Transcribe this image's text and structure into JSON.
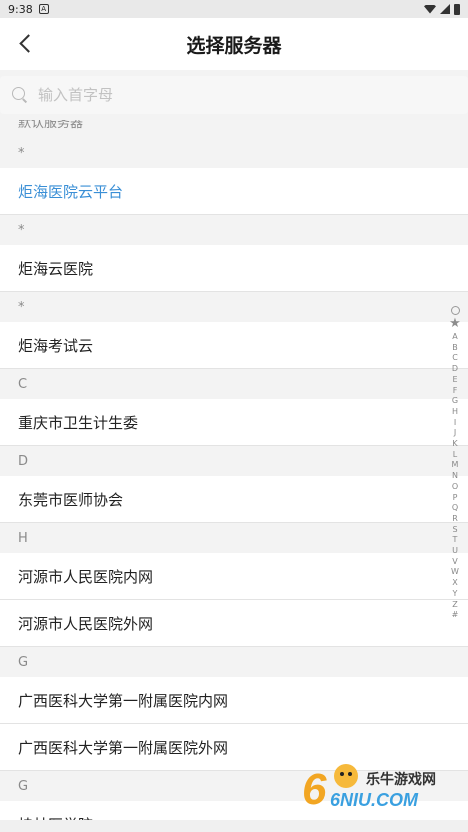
{
  "status": {
    "time": "9:38",
    "badge": "A"
  },
  "header": {
    "title": "选择服务器"
  },
  "search": {
    "placeholder": "输入首字母"
  },
  "list": {
    "partial_header": "默认服务器",
    "items": [
      {
        "type": "section",
        "text": "*"
      },
      {
        "type": "row",
        "text": "炬海医院云平台",
        "active": true
      },
      {
        "type": "section",
        "text": "*"
      },
      {
        "type": "row",
        "text": "炬海云医院"
      },
      {
        "type": "section",
        "text": "*"
      },
      {
        "type": "row",
        "text": "炬海考试云"
      },
      {
        "type": "section",
        "text": "C"
      },
      {
        "type": "row",
        "text": "重庆市卫生计生委"
      },
      {
        "type": "section",
        "text": "D"
      },
      {
        "type": "row",
        "text": "东莞市医师协会"
      },
      {
        "type": "section",
        "text": "H"
      },
      {
        "type": "row",
        "text": "河源市人民医院内网"
      },
      {
        "type": "row",
        "text": "河源市人民医院外网"
      },
      {
        "type": "section",
        "text": "G"
      },
      {
        "type": "row",
        "text": "广西医科大学第一附属医院内网"
      },
      {
        "type": "row",
        "text": "广西医科大学第一附属医院外网"
      },
      {
        "type": "section",
        "text": "G"
      },
      {
        "type": "row",
        "text": "桂林医学院"
      }
    ]
  },
  "index_bar": {
    "letters": [
      "A",
      "B",
      "C",
      "D",
      "E",
      "F",
      "G",
      "H",
      "I",
      "J",
      "K",
      "L",
      "M",
      "N",
      "O",
      "P",
      "Q",
      "R",
      "S",
      "T",
      "U",
      "V",
      "W",
      "X",
      "Y",
      "Z",
      "#"
    ]
  },
  "colors": {
    "accent": "#3a8fd6",
    "section_bg": "#f3f3f3"
  },
  "watermark": {
    "text": "乐牛游戏网",
    "logo": "6NIU.COM"
  }
}
